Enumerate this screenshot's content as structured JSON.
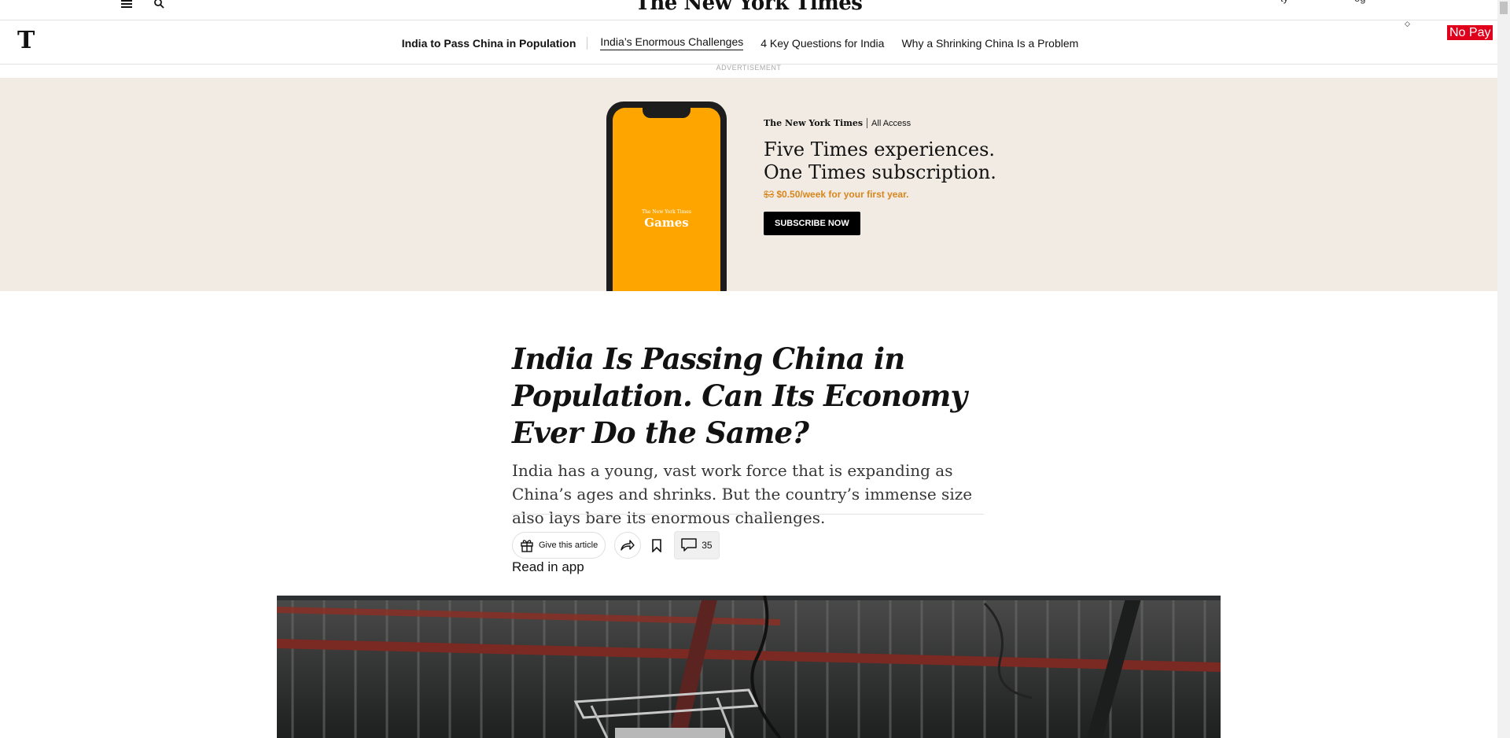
{
  "masthead": {
    "logo": "The New York Times",
    "menu_icon": "menu-icon",
    "search_icon": "search-icon",
    "right_fragments": [
      "ty",
      "og"
    ]
  },
  "nav": {
    "logo": "T",
    "main": "India to Pass China in Population",
    "links": [
      "India’s Enormous Challenges",
      "4 Key Questions for India",
      "Why a Shrinking China Is a Problem"
    ],
    "active_index": 0,
    "dot": "◇",
    "extension_label": "No Pay"
  },
  "ad": {
    "label": "ADVERTISEMENT",
    "phone_small": "The New York Times",
    "phone_app": "Games",
    "brand_logo": "The New York Times",
    "brand_product": "All Access",
    "headline_line1": "Five Times experiences.",
    "headline_line2": "One Times subscription.",
    "old_price": "$3",
    "offer": "$0.50/week for your first year.",
    "cta": "SUBSCRIBE NOW",
    "colors": {
      "background": "#f2ebe3",
      "screen": "#ffa500",
      "offer": "#d7861d"
    }
  },
  "article": {
    "headline": "India Is Passing China in Population. Can Its Economy Ever Do the Same?",
    "summary": "India has a young, vast work force that is expanding as China’s ages and shrinks. But the country’s immense size also lays bare its enormous challenges.",
    "gift_label": "Give this article",
    "comments_count": "35",
    "read_in_app": "Read in app"
  }
}
